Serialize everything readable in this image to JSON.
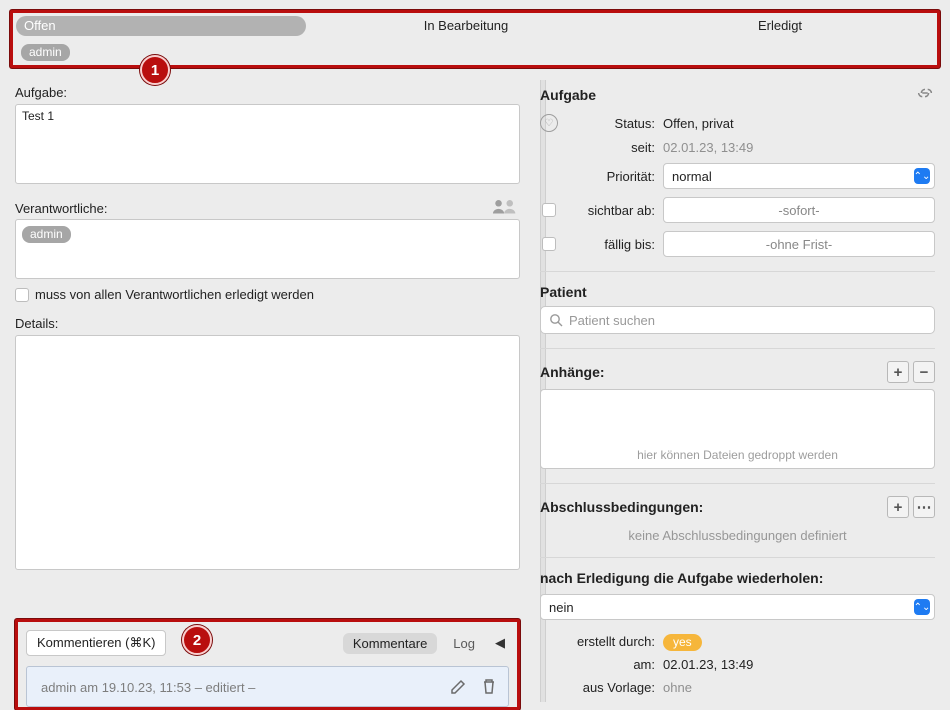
{
  "statusTabs": {
    "open": "Offen",
    "inProgress": "In Bearbeitung",
    "done": "Erledigt"
  },
  "userChip": "admin",
  "annot": {
    "one": "1",
    "two": "2"
  },
  "left": {
    "taskLabel": "Aufgabe:",
    "taskTitle": "Test 1",
    "responsibleLabel": "Verantwortliche:",
    "responsibleChip": "admin",
    "mustAll": "muss von allen Verantwortlichen erledigt werden",
    "detailsLabel": "Details:"
  },
  "comments": {
    "button": "Kommentieren (⌘K)",
    "tabComments": "Kommentare",
    "tabLog": "Log",
    "entry": "admin am 19.10.23, 11:53 – editiert –"
  },
  "right": {
    "header": "Aufgabe",
    "status_k": "Status:",
    "status_v": "Offen, privat",
    "since_k": "seit:",
    "since_v": "02.01.23, 13:49",
    "prio_k": "Priorität:",
    "prio_v": "normal",
    "visible_k": "sichtbar ab:",
    "visible_ph": "-sofort-",
    "due_k": "fällig bis:",
    "due_ph": "-ohne Frist-",
    "patientHeader": "Patient",
    "patientSearchPh": "Patient suchen",
    "attHeader": "Anhänge:",
    "dropHint": "hier können Dateien gedroppt werden",
    "condHeader": "Abschlussbedingungen:",
    "condEmpty": "keine Abschlussbedingungen definiert",
    "repeatHeader": "nach Erledigung die Aufgabe wiederholen:",
    "repeatValue": "nein",
    "createdBy_k": "erstellt durch:",
    "createdBy_v": "yes",
    "createdAt_k": "am:",
    "createdAt_v": "02.01.23, 13:49",
    "template_k": "aus Vorlage:",
    "template_v": "ohne"
  }
}
